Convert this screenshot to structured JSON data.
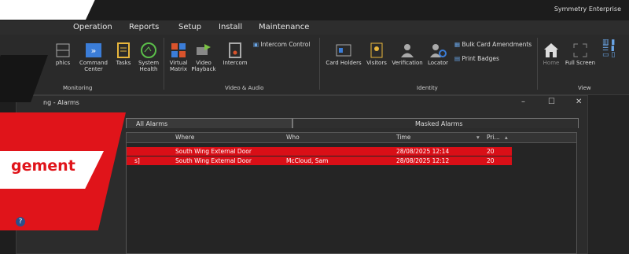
{
  "header": {
    "brand": "Symmetry Enterprise"
  },
  "menu": [
    "Operation",
    "Reports",
    "Setup",
    "Install",
    "Maintenance"
  ],
  "ribbon": {
    "buttons": [
      {
        "label": "phics",
        "icon": "graphics-icon"
      },
      {
        "label": "Command Center",
        "icon": "command-center-icon"
      },
      {
        "label": "Tasks",
        "icon": "tasks-icon"
      },
      {
        "label": "System Health",
        "icon": "system-health-icon"
      },
      {
        "label": "Virtual Matrix",
        "icon": "virtual-matrix-icon"
      },
      {
        "label": "Video Playback",
        "icon": "video-playback-icon"
      },
      {
        "label": "Intercom",
        "icon": "intercom-icon"
      },
      {
        "label": "Card Holders",
        "icon": "card-holders-icon"
      },
      {
        "label": "Visitors",
        "icon": "visitors-icon"
      },
      {
        "label": "Verification",
        "icon": "verification-icon"
      },
      {
        "label": "Locator",
        "icon": "locator-icon"
      },
      {
        "label": "Home",
        "icon": "home-icon"
      },
      {
        "label": "Full Screen",
        "icon": "full-screen-icon"
      }
    ],
    "links": {
      "intercom_control": "Intercom Control",
      "bulk_card": "Bulk Card Amendments",
      "print_badges": "Print Badges"
    },
    "groups": {
      "monitoring": "Monitoring",
      "video_audio": "Video & Audio",
      "identity": "Identity",
      "view": "View"
    }
  },
  "window": {
    "title": "ng - Alarms",
    "controls": {
      "minimize": "–",
      "maximize": "☐",
      "close": "✕"
    },
    "tabs": [
      "All Alarms",
      "Masked Alarms"
    ]
  },
  "table": {
    "columns": [
      "Where",
      "Who",
      "Time",
      "Pri..."
    ],
    "rows": [
      {
        "prefix": "",
        "where": "South Wing External Door",
        "who": "",
        "time": "28/08/2025 12:14",
        "pri": "20"
      },
      {
        "prefix": "s]",
        "where": "South Wing External Door",
        "who": "McCloud, Sam",
        "time": "28/08/2025 12:12",
        "pri": "20"
      }
    ]
  },
  "overlay": {
    "text": "gement"
  },
  "colors": {
    "alarm_row": "#d90f17",
    "banner_red": "#e0141a"
  }
}
